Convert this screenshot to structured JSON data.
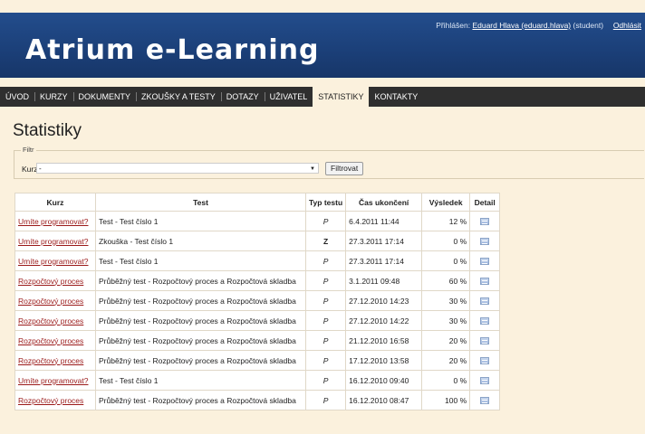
{
  "header": {
    "title": "Atrium e-Learning",
    "signed_in_label": "Přihlášen:",
    "user_link": "Eduard Hlava (eduard.hlava)",
    "user_role": "(student)",
    "logout": "Odhlásit"
  },
  "nav": {
    "items": [
      "ÚVOD",
      "KURZY",
      "DOKUMENTY",
      "ZKOUŠKY A TESTY",
      "DOTAZY",
      "UŽIVATEL",
      "STATISTIKY",
      "KONTAKTY"
    ],
    "active": "STATISTIKY"
  },
  "page": {
    "title": "Statistiky"
  },
  "filter": {
    "legend": "Filtr",
    "kurz_label": "Kurz",
    "selected": "-",
    "button": "Filtrovat"
  },
  "table": {
    "headers": [
      "Kurz",
      "Test",
      "Typ testu",
      "Čas ukončení",
      "Výsledek",
      "Detail"
    ],
    "rows": [
      [
        "Umíte programovat?",
        "Test - Test číslo 1",
        "P",
        "6.4.2011 11:44",
        "12 %"
      ],
      [
        "Umíte programovat?",
        "Zkouška - Test číslo 1",
        "Z",
        "27.3.2011 17:14",
        "0 %"
      ],
      [
        "Umíte programovat?",
        "Test - Test číslo 1",
        "P",
        "27.3.2011 17:14",
        "0 %"
      ],
      [
        "Rozpočtový proces",
        "Průběžný test - Rozpočtový proces a Rozpočtová skladba",
        "P",
        "3.1.2011 09:48",
        "60 %"
      ],
      [
        "Rozpočtový proces",
        "Průběžný test - Rozpočtový proces a Rozpočtová skladba",
        "P",
        "27.12.2010 14:23",
        "30 %"
      ],
      [
        "Rozpočtový proces",
        "Průběžný test - Rozpočtový proces a Rozpočtová skladba",
        "P",
        "27.12.2010 14:22",
        "30 %"
      ],
      [
        "Rozpočtový proces",
        "Průběžný test - Rozpočtový proces a Rozpočtová skladba",
        "P",
        "21.12.2010 16:58",
        "20 %"
      ],
      [
        "Rozpočtový proces",
        "Průběžný test - Rozpočtový proces a Rozpočtová skladba",
        "P",
        "17.12.2010 13:58",
        "20 %"
      ],
      [
        "Umíte programovat?",
        "Test - Test číslo 1",
        "P",
        "16.12.2010 09:40",
        "0 %"
      ],
      [
        "Rozpočtový proces",
        "Průběžný test - Rozpočtový proces a Rozpočtová skladba",
        "P",
        "16.12.2010 08:47",
        "100 %"
      ]
    ],
    "detail_icon": "detail-icon"
  },
  "colors": {
    "header_blue": "#1b3f78",
    "nav_dark": "#2f2f2f",
    "page_bg": "#fbf1dd",
    "link_red": "#9b1a1a"
  }
}
